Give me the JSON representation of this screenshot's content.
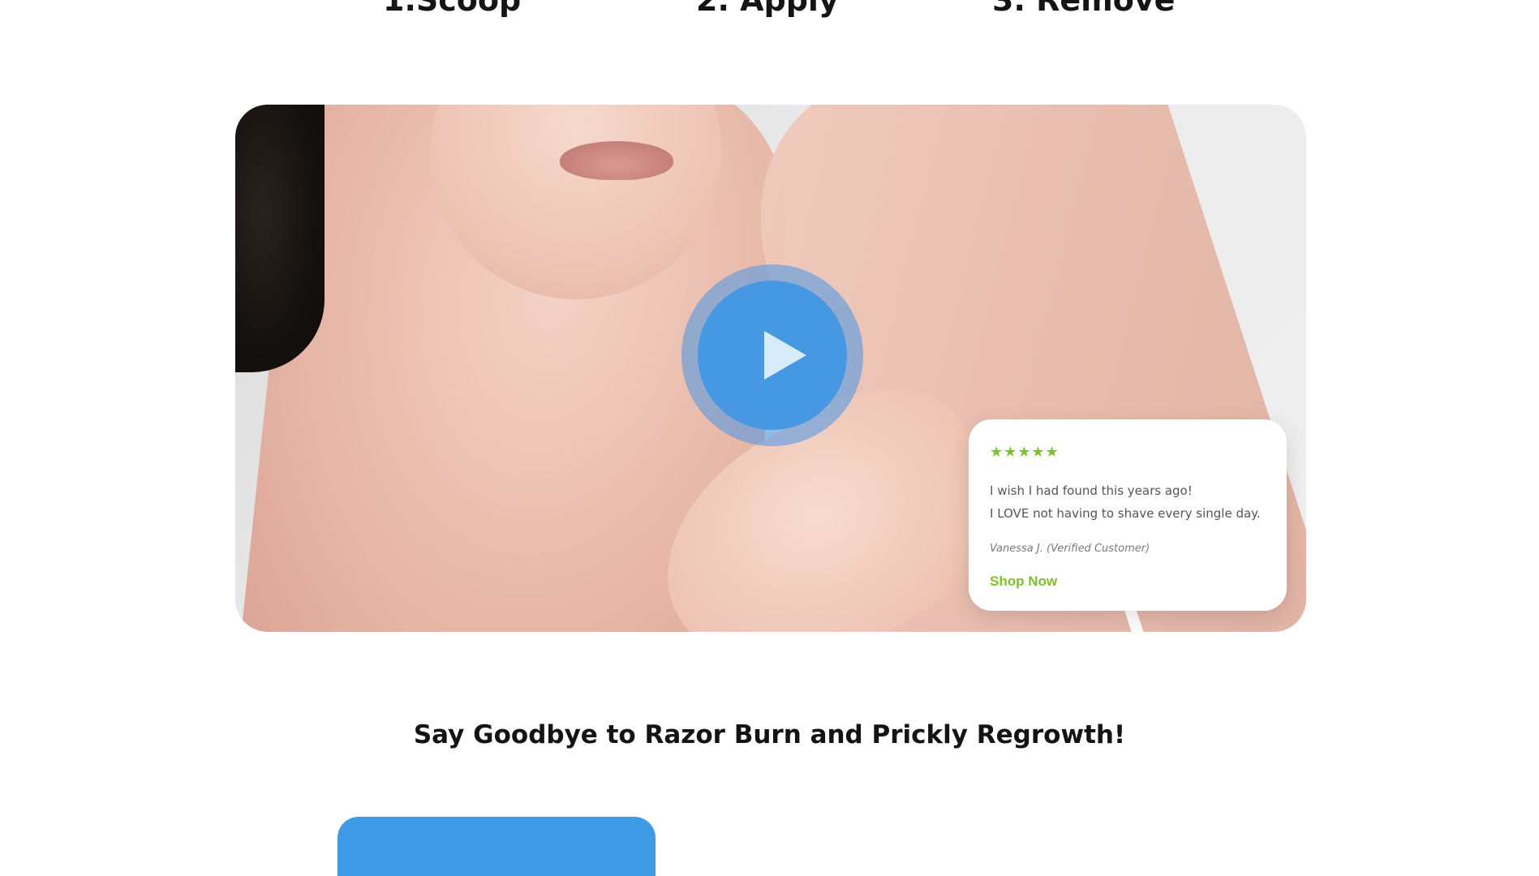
{
  "steps": [
    {
      "label": "1.Scoop"
    },
    {
      "label": "2. Apply"
    },
    {
      "label": "3. Remove"
    }
  ],
  "video": {
    "play_icon": "play-icon",
    "accent_color": "#4698e2"
  },
  "review": {
    "stars_text": "★★★★★",
    "star_icon": "star-icon",
    "rating": 5,
    "line1": "I wish I had found this years ago!",
    "line2": "I LOVE not having to shave every single day.",
    "reviewer": "Vanessa J. (Verified Customer)",
    "cta_label": "Shop Now",
    "cta_color": "#7dc22e"
  },
  "headline": "Say Goodbye to Razor Burn and Prickly Regrowth!",
  "colors": {
    "brand_blue": "#3e9ae4",
    "brand_green": "#7dc22e",
    "text_dark": "#141414"
  }
}
